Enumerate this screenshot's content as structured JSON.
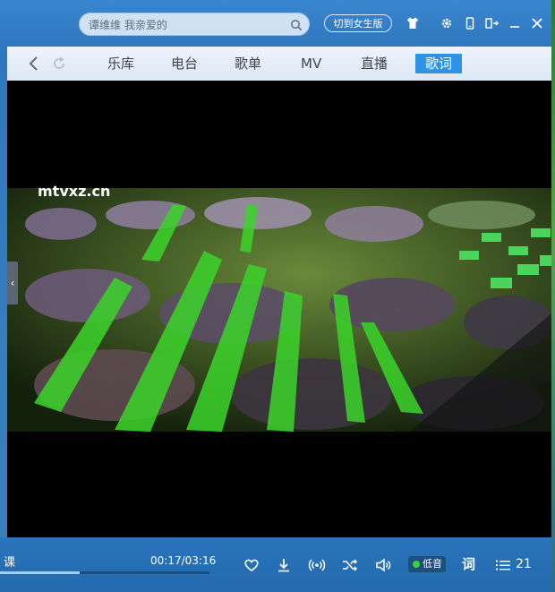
{
  "title_bar": {
    "search_placeholder": "谭维维 我亲爱的",
    "switch_version_label": "切到女生版"
  },
  "nav": {
    "items": [
      {
        "label": "乐库"
      },
      {
        "label": "电台"
      },
      {
        "label": "歌单"
      },
      {
        "label": "MV"
      },
      {
        "label": "直播"
      },
      {
        "label": "歌词"
      }
    ],
    "active_index": 5
  },
  "video": {
    "watermark": "mtvxz.cn"
  },
  "player": {
    "song_fragment": "课",
    "time": "00:17/03:16",
    "progress": 0.38,
    "quality_label": "低音",
    "lyric_label": "词",
    "playlist_count": "21"
  },
  "left_handle": {
    "glyph": "‹"
  },
  "colors": {
    "accent": "#2e93e6",
    "titlebar": "#3a86cf",
    "quality_dot": "#3ad13a"
  }
}
